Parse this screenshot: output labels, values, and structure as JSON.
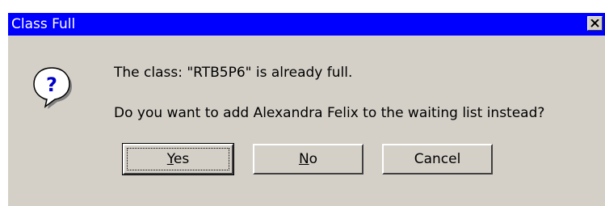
{
  "window": {
    "title": "Class Full",
    "close_glyph": "×"
  },
  "icon": {
    "name": "question-icon",
    "glyph": "?"
  },
  "message": {
    "line1": "The class: \"RTB5P6\" is already full.",
    "line2": "Do you want to add Alexandra Felix to the waiting list instead?"
  },
  "buttons": {
    "yes": {
      "mnemonic": "Y",
      "rest": "es"
    },
    "no": {
      "mnemonic": "N",
      "rest": "o"
    },
    "cancel": {
      "label": "Cancel"
    }
  },
  "colors": {
    "titlebar": "#0000ff",
    "face": "#d4d0c8",
    "icon_glyph": "#0000c8"
  }
}
